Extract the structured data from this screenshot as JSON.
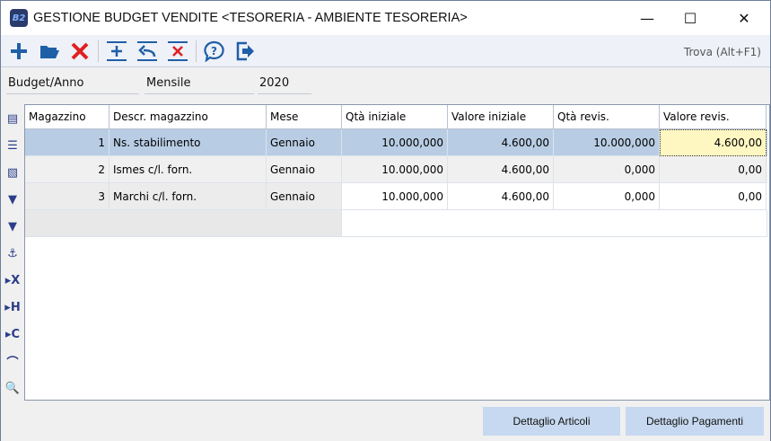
{
  "window": {
    "title": "GESTIONE BUDGET VENDITE <TESORERIA - AMBIENTE TESORERIA>",
    "logo": "B2"
  },
  "toolbar": {
    "icons": [
      "plus-icon",
      "folder-open-icon",
      "delete-icon",
      "insert-row-icon",
      "undo-row-icon",
      "delete-row-icon",
      "help-icon",
      "exit-icon"
    ],
    "find_label": "Trova (Alt+F1)"
  },
  "form": {
    "budget_label": "Budget/Anno",
    "period": "Mensile",
    "year": "2020"
  },
  "sidebar": {
    "icons": [
      "card-icon",
      "list-icon",
      "table-icon",
      "filter-icon",
      "filter-options-icon",
      "anchor-icon",
      "x-icon",
      "h-icon",
      "c-icon",
      "chart-icon",
      "preview-icon"
    ]
  },
  "grid": {
    "columns": [
      "Magazzino",
      "Descr. magazzino",
      "Mese",
      "Qtà iniziale",
      "Valore iniziale",
      "Qtà revis.",
      "Valore revis."
    ],
    "rows": [
      [
        "1",
        "Ns. stabilimento",
        "Gennaio",
        "10.000,000",
        "4.600,00",
        "10.000,000",
        "4.600,00"
      ],
      [
        "2",
        "Ismes c/l. forn.",
        "Gennaio",
        "10.000,000",
        "4.600,00",
        "0,000",
        "0,00"
      ],
      [
        "3",
        "Marchi c/l. forn.",
        "Gennaio",
        "10.000,000",
        "4.600,00",
        "0,000",
        "0,00"
      ]
    ]
  },
  "footer": {
    "dettaglio_articoli": "Dettaglio Articoli",
    "dettaglio_pagamenti": "Dettaglio Pagamenti"
  },
  "colors": {
    "selected_row": "#b8cde4",
    "active_cell": "#fff7c2",
    "button": "#c7d9f0",
    "icon_blue": "#1f5fa8",
    "icon_red": "#e02020"
  }
}
